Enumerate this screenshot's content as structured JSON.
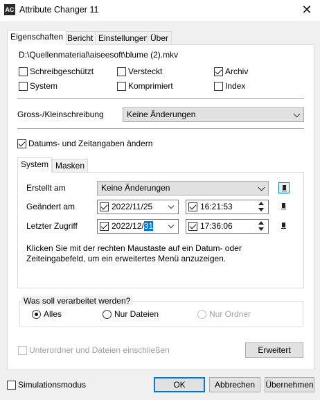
{
  "window": {
    "title": "Attribute Changer 11",
    "app_icon_text": "AC"
  },
  "tabs": [
    {
      "label": "Eigenschaften",
      "active": true
    },
    {
      "label": "Bericht",
      "active": false
    },
    {
      "label": "Einstellungen",
      "active": false
    },
    {
      "label": "Über",
      "active": false
    }
  ],
  "file_path": "D:\\Quellenmaterial\\aiseesoft\\blume (2).mkv",
  "attributes": [
    {
      "label": "Schreibgeschützt",
      "checked": false
    },
    {
      "label": "Versteckt",
      "checked": false
    },
    {
      "label": "Archiv",
      "checked": true
    },
    {
      "label": "System",
      "checked": false
    },
    {
      "label": "Komprimiert",
      "checked": false
    },
    {
      "label": "Index",
      "checked": false
    }
  ],
  "case": {
    "label": "Gross-/Kleinschreibung",
    "value": "Keine Änderungen"
  },
  "datetime": {
    "checkbox_label": "Datums- und Zeitangaben ändern",
    "checked": true,
    "subtabs": [
      {
        "label": "System",
        "active": true
      },
      {
        "label": "Masken",
        "active": false
      }
    ],
    "created": {
      "label": "Erstellt am",
      "value": "Keine Änderungen"
    },
    "modified": {
      "label": "Geändert am",
      "date": "2022/11/25",
      "time": "16:21:53"
    },
    "accessed": {
      "label": "Letzter Zugriff",
      "date_prefix": "2022/12/",
      "date_selected": "31",
      "time": "17:36:06"
    },
    "hint": "Klicken Sie mit der rechten Maustaste auf ein Datum- oder Zeiteingabefeld, um ein erweitertes Menü anzuzeigen."
  },
  "process": {
    "title": "Was soll verarbeitet werden?",
    "options": [
      {
        "label": "Alles",
        "checked": true,
        "disabled": false
      },
      {
        "label": "Nur Dateien",
        "checked": false,
        "disabled": false
      },
      {
        "label": "Nur Ordner",
        "checked": false,
        "disabled": true
      }
    ]
  },
  "subfolders": {
    "label": "Unterordner und Dateien einschließen",
    "checked": false,
    "disabled": true
  },
  "advanced_button": "Erweitert",
  "simulation": {
    "label": "Simulationsmodus",
    "checked": false
  },
  "buttons": {
    "ok": "OK",
    "cancel": "Abbrechen",
    "apply": "Übernehmen"
  }
}
